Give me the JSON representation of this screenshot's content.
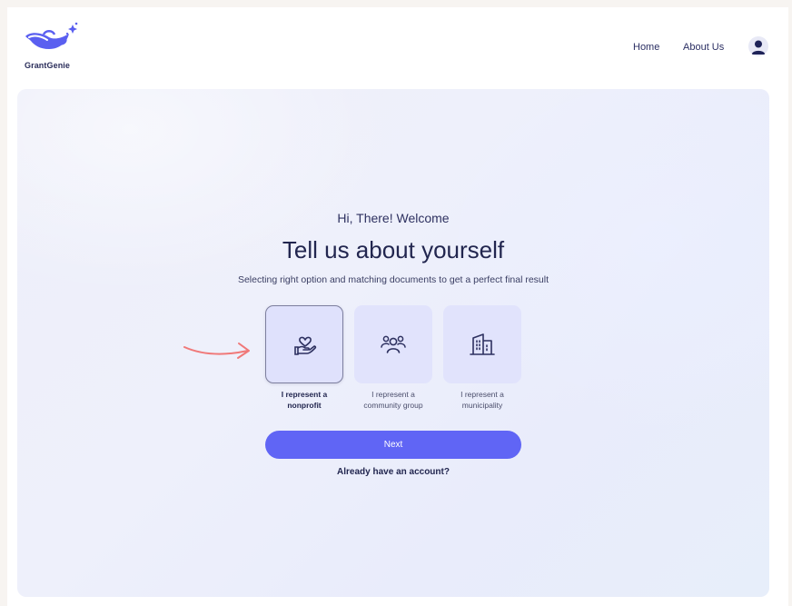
{
  "brand": {
    "name": "GrantGenie",
    "logo_icon": "genie-lamp-icon",
    "accent_color": "#5a5ff0"
  },
  "nav": {
    "home_label": "Home",
    "about_label": "About Us",
    "profile_icon": "user-avatar-icon"
  },
  "onboarding": {
    "greeting": "Hi, There! Welcome",
    "title": "Tell us about yourself",
    "subtitle": "Selecting right option and matching documents to get a perfect final result",
    "options": [
      {
        "icon": "hand-heart-icon",
        "label_line1": "I represent a",
        "label_line2": "nonprofit",
        "selected": true
      },
      {
        "icon": "community-group-icon",
        "label_line1": "I represent a",
        "label_line2": "community group",
        "selected": false
      },
      {
        "icon": "building-icon",
        "label_line1": "I represent a",
        "label_line2": "municipality",
        "selected": false
      }
    ],
    "next_label": "Next",
    "account_link": "Already have an account?",
    "button_color": "#6065f5"
  }
}
